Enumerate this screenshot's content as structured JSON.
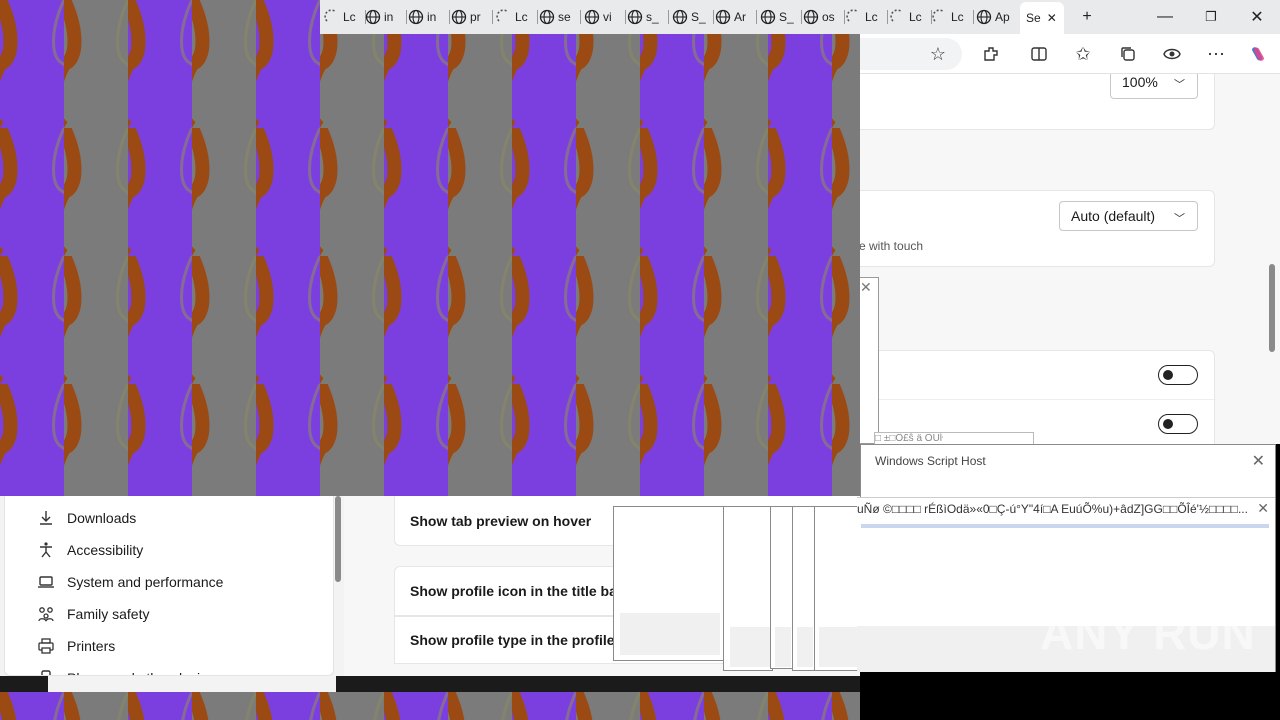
{
  "browser": {
    "tabs": [
      {
        "label": "Lc",
        "icon": "loading-icon"
      },
      {
        "label": "in",
        "icon": "globe-icon"
      },
      {
        "label": "in",
        "icon": "globe-icon"
      },
      {
        "label": "pr",
        "icon": "globe-icon"
      },
      {
        "label": "Lc",
        "icon": "loading-icon"
      },
      {
        "label": "se",
        "icon": "globe-icon"
      },
      {
        "label": "vi",
        "icon": "globe-icon"
      },
      {
        "label": "s_",
        "icon": "globe-icon"
      },
      {
        "label": "S_",
        "icon": "globe-icon"
      },
      {
        "label": "Ar",
        "icon": "globe-icon"
      },
      {
        "label": "S_",
        "icon": "globe-icon"
      },
      {
        "label": "os",
        "icon": "globe-icon"
      },
      {
        "label": "Lc",
        "icon": "loading-icon"
      },
      {
        "label": "Lc",
        "icon": "loading-icon"
      },
      {
        "label": "Lc",
        "icon": "loading-icon"
      },
      {
        "label": "Ap",
        "icon": "globe-icon"
      },
      {
        "label": "Se",
        "icon": "settings-icon",
        "active": true
      }
    ],
    "new_tab": "+",
    "window_controls": {
      "minimize": "—",
      "restore": "❐",
      "close": "✕"
    }
  },
  "settings": {
    "zoom_value": "100%",
    "toolbar_mode_value": "Auto (default)",
    "touch_hint": "e with touch",
    "main_items": [
      "Show tab preview on hover",
      "Show profile icon in the title bar",
      "Show profile type in the profile l"
    ],
    "sidebar_items": [
      {
        "label": "Downloads",
        "icon": "download-icon"
      },
      {
        "label": "Accessibility",
        "icon": "accessibility-icon"
      },
      {
        "label": "System and performance",
        "icon": "laptop-icon"
      },
      {
        "label": "Family safety",
        "icon": "family-icon"
      },
      {
        "label": "Printers",
        "icon": "printer-icon"
      },
      {
        "label": "Phone and other devices",
        "icon": "phone-icon"
      }
    ]
  },
  "dialogs": {
    "wsh_title": "Windows Script Host",
    "error_text": "uÑø ©□□□□ rÉßìOdä»«0□Ç-ú°Y\"4í□A EuúÕ%u)+âdZ]GG□□ÕÎé'½□□□□...",
    "small_popup_text": "□ ±□Ô£ŝ ä ÕUŀ"
  },
  "watermark": "ANY RUN",
  "colors": {
    "stripe_purple": "#7b3fe0",
    "stripe_gray": "#7b7b7b",
    "wave_brown": "#9a4a12"
  }
}
